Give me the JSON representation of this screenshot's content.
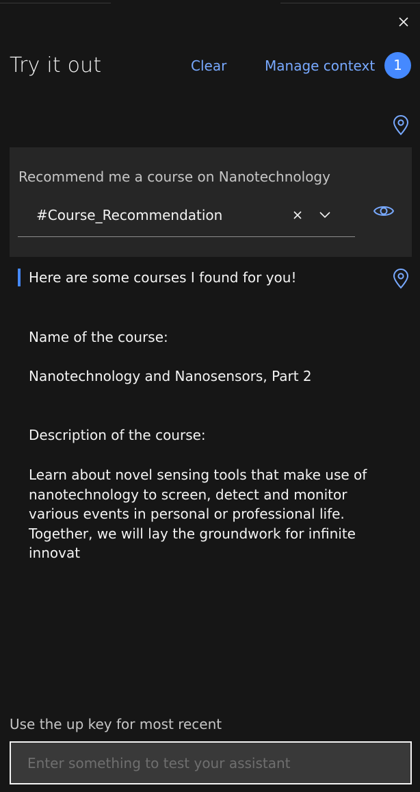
{
  "panel": {
    "title": "Try it out",
    "clear_label": "Clear",
    "manage_context_label": "Manage context",
    "context_count": "1",
    "close_icon": "close-icon"
  },
  "user_message": {
    "text": "Recommend me a course on Nanotechnology",
    "intent": "#Course_Recommendation",
    "icons": [
      "location-pin-icon",
      "close-icon",
      "chevron-down-icon",
      "eye-icon"
    ]
  },
  "bot_response": {
    "greeting": "Here are some courses I found for you!",
    "name_label": "Name of the course:",
    "name_value": "Nanotechnology and Nanosensors, Part 2",
    "description_label": "Description of the course:",
    "description_value": "Learn about novel sensing tools that make use of nanotechnology to screen, detect and monitor various events in personal or professional life. Together, we will lay the groundwork for infinite innovat"
  },
  "input": {
    "hint": "Use the up key for most recent",
    "placeholder": "Enter something to test your assistant",
    "value": ""
  },
  "colors": {
    "background": "#161616",
    "surface": "#262626",
    "link": "#78a9ff",
    "accent": "#4589ff",
    "text": "#f4f4f4",
    "muted_text": "#c6c6c6",
    "input_bg": "#393939"
  }
}
